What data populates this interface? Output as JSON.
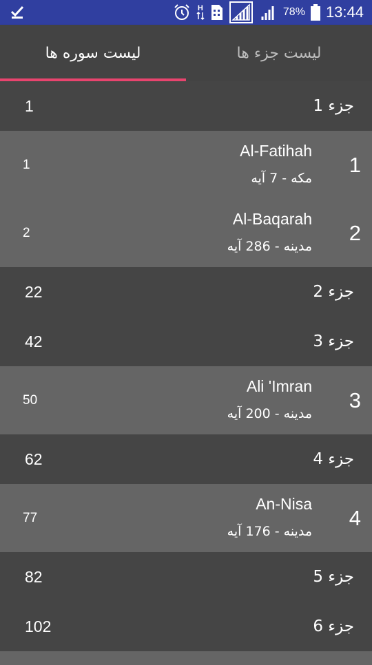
{
  "status_bar": {
    "battery_percent": "78%",
    "time": "13:44",
    "h_label": "H",
    "icons": [
      "checkmark-icon",
      "alarm-icon",
      "data-arrows-icon",
      "sim-icon",
      "signal-icon",
      "signal-icon",
      "battery-icon"
    ]
  },
  "tabs": [
    {
      "label": "لیست جزء ها",
      "active": false
    },
    {
      "label": "لیست سوره ها",
      "active": true
    }
  ],
  "rows": [
    {
      "type": "juz",
      "label": "جزء 1",
      "page": "1"
    },
    {
      "type": "surah",
      "number": "1",
      "name": "Al-Fatihah",
      "info": "مکه - 7 آیه",
      "page": "1"
    },
    {
      "type": "surah",
      "number": "2",
      "name": "Al-Baqarah",
      "info": "مدینه - 286 آیه",
      "page": "2"
    },
    {
      "type": "juz",
      "label": "جزء 2",
      "page": "22"
    },
    {
      "type": "juz",
      "label": "جزء 3",
      "page": "42"
    },
    {
      "type": "surah",
      "number": "3",
      "name": "Ali 'Imran",
      "info": "مدینه - 200 آیه",
      "page": "50"
    },
    {
      "type": "juz",
      "label": "جزء 4",
      "page": "62"
    },
    {
      "type": "surah",
      "number": "4",
      "name": "An-Nisa",
      "info": "مدینه - 176 آیه",
      "page": "77"
    },
    {
      "type": "juz",
      "label": "جزء 5",
      "page": "82"
    },
    {
      "type": "juz",
      "label": "جزء 6",
      "page": "102"
    }
  ],
  "colors": {
    "status_bar": "#303fa0",
    "tab_background": "#434343",
    "tab_indicator": "#e8446e",
    "juz_row": "#454545",
    "surah_row": "#656565"
  }
}
